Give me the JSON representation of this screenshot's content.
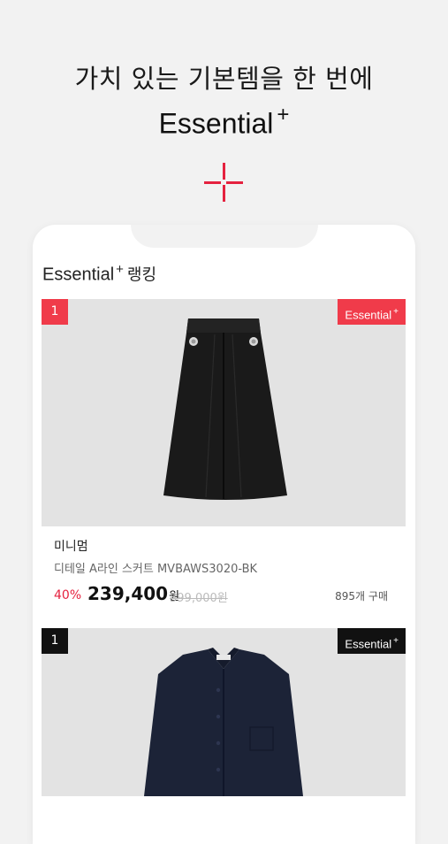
{
  "promo": {
    "headline": "가치 있는 기본템을 한 번에",
    "brand": "Essential",
    "brand_plus": "+"
  },
  "section": {
    "title": "Essential",
    "title_plus": "+",
    "title_suffix": "랭킹"
  },
  "products": [
    {
      "rank": "1",
      "badge": "Essential",
      "badge_plus": "+",
      "badge_color": "#f03b4a",
      "brand": "미니멈",
      "name": "디테일 A라인 스커트 MVBAWS3020-BK",
      "discount": "40%",
      "price": "239,400",
      "price_unit": "원",
      "original_price": "399,000원",
      "purchase_count": "895개 구매",
      "image": "black-a-line-skirt"
    },
    {
      "rank": "1",
      "badge": "Essential",
      "badge_plus": "+",
      "badge_color": "#111111",
      "image": "navy-knit-cardigan"
    }
  ],
  "colors": {
    "accent": "#e5223f",
    "background": "#f2f2f2"
  }
}
